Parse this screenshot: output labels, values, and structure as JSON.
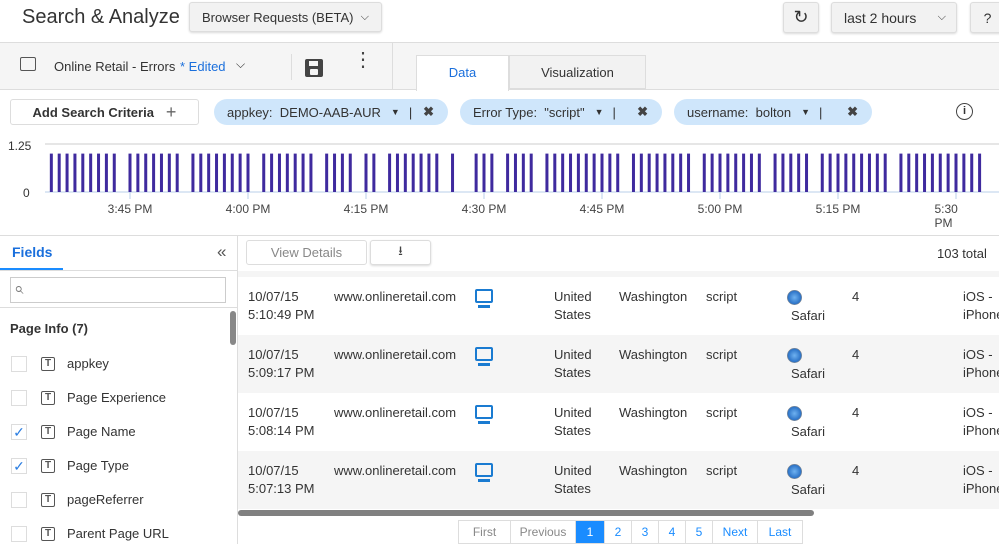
{
  "header": {
    "title": "Search & Analyze",
    "source_select": "Browser Requests (BETA)",
    "time_range": "last 2 hours",
    "help": "?",
    "refresh_icon": "refresh-icon"
  },
  "toolbar": {
    "search_name": "Online Retail - Errors",
    "edited": "* Edited",
    "tabs": [
      {
        "label": "Data",
        "active": true
      },
      {
        "label": "Visualization",
        "active": false
      }
    ]
  },
  "criteria": {
    "add_label": "Add Search Criteria",
    "add_icon": "+",
    "filters": [
      {
        "label": "appkey:",
        "value": "DEMO-AAB-AUR"
      },
      {
        "label": "Error Type:",
        "value": "\"script\""
      },
      {
        "label": "username:",
        "value": "bolton"
      }
    ],
    "separator": "|",
    "remove": "✖",
    "info": "i"
  },
  "chart_data": {
    "type": "bar",
    "ylim": [
      0,
      1.25
    ],
    "y_ticks": [
      "0",
      "1.25"
    ],
    "x_ticks": [
      "3:45 PM",
      "4:00 PM",
      "4:15 PM",
      "4:30 PM",
      "4:45 PM",
      "5:00 PM",
      "5:15 PM",
      "5:30 PM"
    ],
    "color": "#3f2a9e",
    "x": [
      "3:35",
      "3:36",
      "3:37",
      "3:38",
      "3:39",
      "3:40",
      "3:41",
      "3:42",
      "3:43",
      "3:45",
      "3:46",
      "3:47",
      "3:48",
      "3:49",
      "3:50",
      "3:51",
      "3:53",
      "3:54",
      "3:55",
      "3:56",
      "3:57",
      "3:58",
      "3:59",
      "4:00",
      "4:02",
      "4:03",
      "4:04",
      "4:05",
      "4:06",
      "4:07",
      "4:08",
      "4:10",
      "4:11",
      "4:12",
      "4:13",
      "4:15",
      "4:16",
      "4:18",
      "4:19",
      "4:20",
      "4:21",
      "4:22",
      "4:23",
      "4:24",
      "4:26",
      "4:29",
      "4:30",
      "4:31",
      "4:33",
      "4:34",
      "4:35",
      "4:36",
      "4:38",
      "4:39",
      "4:40",
      "4:41",
      "4:42",
      "4:43",
      "4:44",
      "4:45",
      "4:46",
      "4:47",
      "4:49",
      "4:50",
      "4:51",
      "4:52",
      "4:53",
      "4:54",
      "4:55",
      "4:56",
      "4:58",
      "4:59",
      "5:00",
      "5:01",
      "5:02",
      "5:03",
      "5:04",
      "5:05",
      "5:07",
      "5:08",
      "5:09",
      "5:10",
      "5:11",
      "5:13",
      "5:14",
      "5:15",
      "5:16",
      "5:17",
      "5:18",
      "5:19",
      "5:20",
      "5:21",
      "5:23",
      "5:24",
      "5:25",
      "5:26",
      "5:27",
      "5:28",
      "5:29",
      "5:30",
      "5:31",
      "5:32",
      "5:33"
    ],
    "values": [
      1,
      1,
      1,
      1,
      1,
      1,
      1,
      1,
      1,
      1,
      1,
      1,
      1,
      1,
      1,
      1,
      1,
      1,
      1,
      1,
      1,
      1,
      1,
      1,
      1,
      1,
      1,
      1,
      1,
      1,
      1,
      1,
      1,
      1,
      1,
      1,
      1,
      1,
      1,
      1,
      1,
      1,
      1,
      1,
      1,
      1,
      1,
      1,
      1,
      1,
      1,
      1,
      1,
      1,
      1,
      1,
      1,
      1,
      1,
      1,
      1,
      1,
      1,
      1,
      1,
      1,
      1,
      1,
      1,
      1,
      1,
      1,
      1,
      1,
      1,
      1,
      1,
      1,
      1,
      1,
      1,
      1,
      1,
      1,
      1,
      1,
      1,
      1,
      1,
      1,
      1,
      1,
      1,
      1,
      1,
      1,
      1,
      1,
      1,
      1,
      1,
      1,
      1
    ]
  },
  "fields": {
    "tab": "Fields",
    "collapse": "«",
    "search_placeholder": "",
    "group": "Page Info (7)",
    "items": [
      {
        "label": "appkey",
        "checked": false
      },
      {
        "label": "Page Experience",
        "checked": false
      },
      {
        "label": "Page Name",
        "checked": true
      },
      {
        "label": "Page Type",
        "checked": true
      },
      {
        "label": "pageReferrer",
        "checked": false
      },
      {
        "label": "Parent Page URL",
        "checked": false
      }
    ]
  },
  "results": {
    "view_details": "View Details",
    "total": "103 total",
    "rows": [
      {
        "date": "10/07/15",
        "time": "5:10:49 PM",
        "url": "www.onlineretail.com",
        "country1": "United",
        "country2": "States",
        "region": "Washington",
        "error": "script",
        "browser": "Safari",
        "count": "4",
        "os1": "iOS -",
        "os2": "iPhone"
      },
      {
        "date": "10/07/15",
        "time": "5:09:17 PM",
        "url": "www.onlineretail.com",
        "country1": "United",
        "country2": "States",
        "region": "Washington",
        "error": "script",
        "browser": "Safari",
        "count": "4",
        "os1": "iOS -",
        "os2": "iPhone"
      },
      {
        "date": "10/07/15",
        "time": "5:08:14 PM",
        "url": "www.onlineretail.com",
        "country1": "United",
        "country2": "States",
        "region": "Washington",
        "error": "script",
        "browser": "Safari",
        "count": "4",
        "os1": "iOS -",
        "os2": "iPhone"
      },
      {
        "date": "10/07/15",
        "time": "5:07:13 PM",
        "url": "www.onlineretail.com",
        "country1": "United",
        "country2": "States",
        "region": "Washington",
        "error": "script",
        "browser": "Safari",
        "count": "4",
        "os1": "iOS -",
        "os2": "iPhone"
      }
    ]
  },
  "pagination": {
    "first": "First",
    "previous": "Previous",
    "pages": [
      "1",
      "2",
      "3",
      "4",
      "5"
    ],
    "current": "1",
    "next": "Next",
    "last": "Last"
  }
}
